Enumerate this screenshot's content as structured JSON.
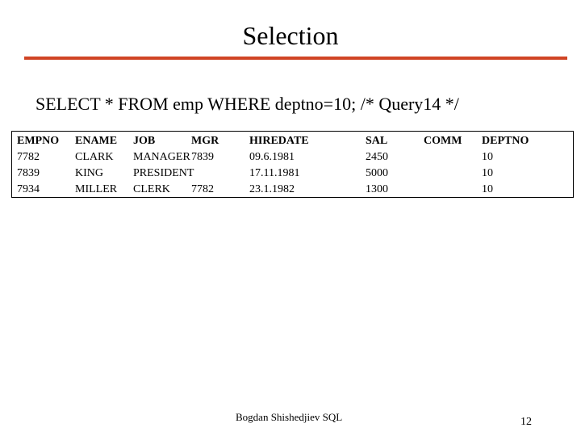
{
  "slide": {
    "title": "Selection",
    "query": "SELECT * FROM emp WHERE deptno=10; /* Query14 */",
    "accent_color": "#D04424",
    "footer": "Bogdan Shishedjiev SQL",
    "page_number": "12"
  },
  "table": {
    "columns": [
      "EMPNO",
      "ENAME",
      "JOB",
      "MGR",
      "HIREDATE",
      "SAL",
      "COMM",
      "DEPTNO"
    ],
    "rows": [
      [
        "7782",
        "CLARK",
        "MANAGER",
        "7839",
        "09.6.1981",
        "2450",
        "",
        "10"
      ],
      [
        "7839",
        "KING",
        "PRESIDENT",
        "",
        "17.11.1981",
        "5000",
        "",
        "10"
      ],
      [
        "7934",
        "MILLER",
        "CLERK",
        "7782",
        "23.1.1982",
        "1300",
        "",
        "10"
      ]
    ]
  }
}
